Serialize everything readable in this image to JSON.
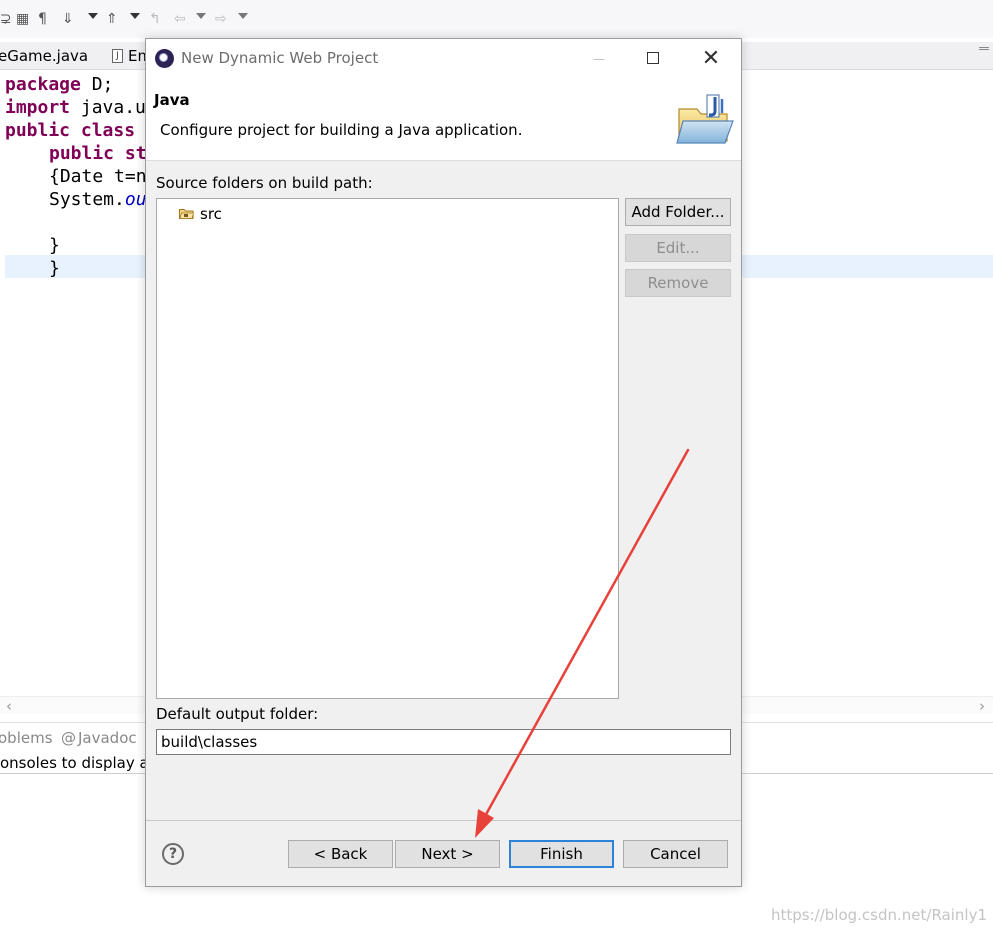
{
  "ide": {
    "editor_tabs": [
      {
        "label": "eGame.java"
      },
      {
        "label": "Em"
      }
    ],
    "code_lines": {
      "l1_kw": "package",
      "l1_rest": " D;",
      "l2_kw": "import",
      "l2_rest": " java.u",
      "l3_kw1": "public",
      "l3_kw2": "class",
      "l3_rest": "",
      "l4_kw": "public",
      "l4_rest": " st",
      "l5": "{Date t=n",
      "l6_a": "System.",
      "l6_b": "ou",
      "l7": "}",
      "l8": "}"
    },
    "view_tabs": {
      "problems": "oblems",
      "javadoc_icon": "@",
      "javadoc": "Javadoc"
    },
    "console_text": "onsoles to display at",
    "watermark": "https://blog.csdn.net/Rainly1"
  },
  "dialog": {
    "title": "New Dynamic Web Project",
    "banner_title": "Java",
    "banner_description": "Configure project for building a Java application.",
    "source_folders_label": "Source folders on build path:",
    "source_folders": [
      {
        "name": "src"
      }
    ],
    "side_buttons": {
      "add_folder": "Add Folder...",
      "edit": "Edit...",
      "remove": "Remove"
    },
    "output_folder_label": "Default output folder:",
    "output_folder_value": "build\\classes",
    "help_symbol": "?",
    "buttons": {
      "back": "< Back",
      "next": "Next >",
      "finish": "Finish",
      "cancel": "Cancel"
    }
  },
  "colors": {
    "annotation_arrow": "#e8413a",
    "keyword": "#7f0055",
    "default_button_border": "#2d83d8"
  }
}
